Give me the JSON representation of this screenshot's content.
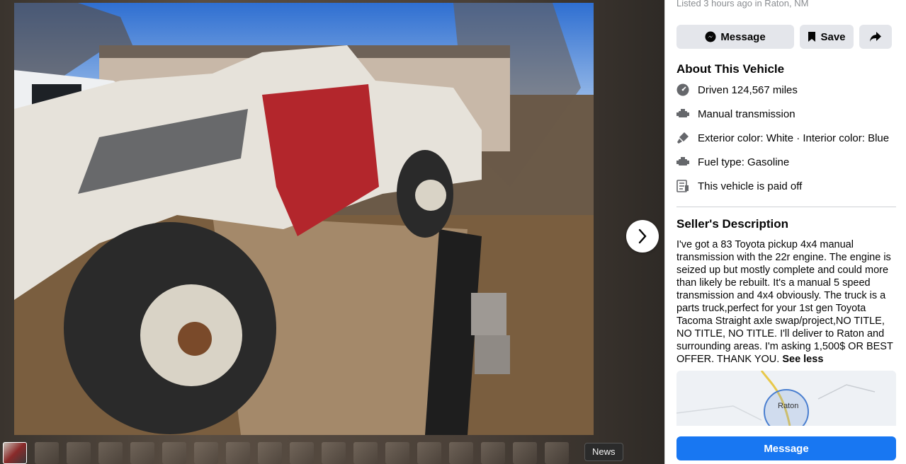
{
  "listing": {
    "listed_text": "Listed 3 hours ago in Raton, NM"
  },
  "actions": {
    "message_label": "Message",
    "save_label": "Save"
  },
  "about": {
    "title": "About This Vehicle",
    "specs": [
      {
        "icon": "speedometer-icon",
        "text": "Driven 124,567 miles"
      },
      {
        "icon": "engine-icon",
        "text": "Manual transmission"
      },
      {
        "icon": "paint-brush-icon",
        "text": "Exterior color: White · Interior color: Blue"
      },
      {
        "icon": "fuel-icon",
        "text": "Fuel type: Gasoline"
      },
      {
        "icon": "document-icon",
        "text": "This vehicle is paid off"
      }
    ]
  },
  "seller": {
    "title": "Seller's Description",
    "description": "I've got a 83 Toyota pickup 4x4 manual transmission with the 22r engine. The engine is seized up but mostly complete and could more than likely be rebuilt. It's a manual 5 speed transmission and 4x4 obviously. The truck is a parts truck,perfect for your 1st gen Toyota Tacoma Straight axle swap/project,NO TITLE, NO TITLE, NO TITLE. I'll deliver to Raton and surrounding areas. I'm asking 1,500$ OR BEST OFFER. THANK YOU.",
    "see_less": "See less"
  },
  "map": {
    "label": "Raton"
  },
  "footer": {
    "message_label": "Message"
  },
  "viewer": {
    "tooltip": "News",
    "thumbnail_count": 18
  },
  "colors": {
    "primary": "#1877f2",
    "button_bg": "#e4e6eb"
  }
}
